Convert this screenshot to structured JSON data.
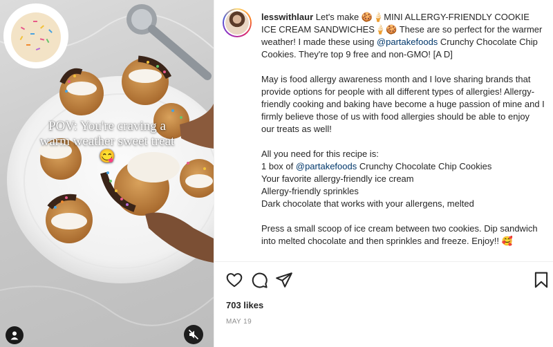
{
  "post": {
    "overlay_text": "POV: You're craving a warm weather sweet treat 😋",
    "username": "lesswithlaur",
    "caption": {
      "p1": {
        "lead": " Let's make 🍪🍦MINI ALLERGY-FRIENDLY COOKIE ICE CREAM SANDWICHES🍦🍪 These are so perfect for the warmer weather! I made these using ",
        "mention": "@partakefoods",
        "tail": " Crunchy Chocolate Chip Cookies. They're top 9 free and non-GMO! [A D]"
      },
      "p2": "May is food allergy awareness month and I love sharing brands that provide options for people with all different types of allergies! Allergy-friendly cooking and baking have become a huge passion of mine and I firmly believe those of us with food allergies should be able to enjoy our treats as well!",
      "p3": {
        "intro": "All you need for this recipe is:",
        "item1_prefix": "1 box of ",
        "item1_mention": "@partakefoods",
        "item1_tail": " Crunchy Chocolate Chip Cookies",
        "item2": "Your favorite allergy-friendly ice cream",
        "item3": "Allergy-friendly sprinkles",
        "item4": "Dark chocolate that works with your allergens, melted"
      },
      "p4": "Press a small scoop of ice cream between two cookies. Dip sandwich into melted chocolate and then sprinkles and freeze. Enjoy!! 🥰"
    },
    "likes": "703 likes",
    "date": "MAY 19"
  },
  "icons": {
    "like": "heart-icon",
    "comment": "comment-icon",
    "share": "paper-plane-icon",
    "save": "bookmark-icon",
    "tag": "user-tag-icon",
    "mute": "muted-speaker-icon"
  }
}
